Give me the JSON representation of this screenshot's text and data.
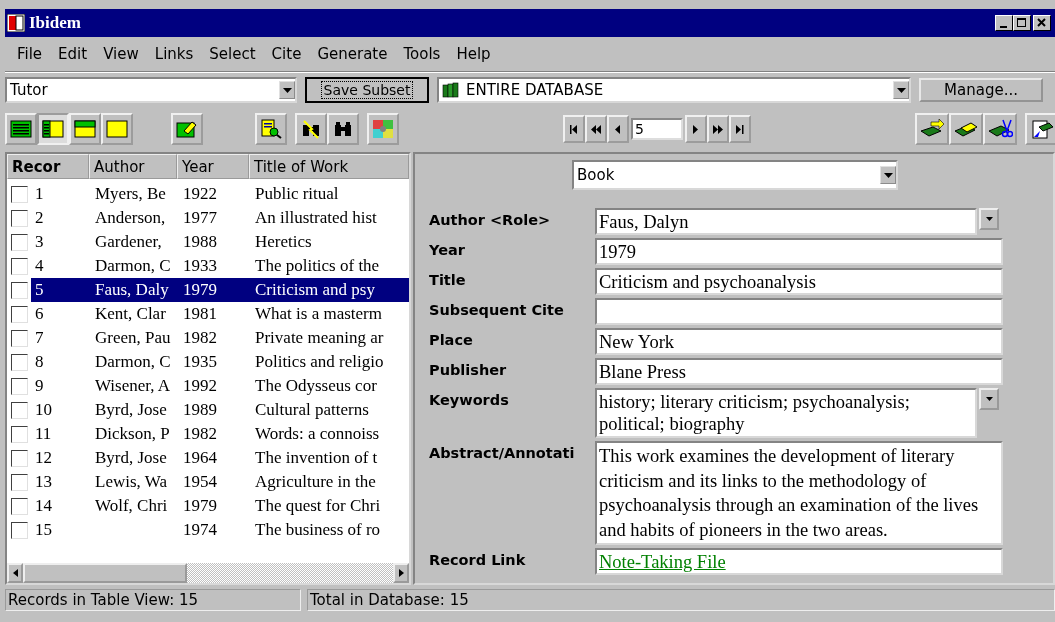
{
  "window": {
    "title": "Ibidem"
  },
  "menu": [
    "File",
    "Edit",
    "View",
    "Links",
    "Select",
    "Cite",
    "Generate",
    "Tools",
    "Help"
  ],
  "database_combo": {
    "value": "Tutor"
  },
  "save_subset_button": "Save Subset",
  "subset_combo": {
    "value": "ENTIRE DATABASE"
  },
  "manage_button": "Manage...",
  "view_buttons": [
    {
      "selected": false
    },
    {
      "selected": true
    },
    {
      "selected": false
    },
    {
      "selected": false
    }
  ],
  "record_navigator": {
    "value": "5"
  },
  "table": {
    "columns": [
      "Recor",
      "Author",
      "Year",
      "Title of Work"
    ],
    "rows": [
      {
        "checked": false,
        "selected": false,
        "record": "1",
        "author": "Myers, Be",
        "year": "1922",
        "title": "Public ritual"
      },
      {
        "checked": false,
        "selected": false,
        "record": "2",
        "author": "Anderson,",
        "year": "1977",
        "title": "An illustrated hist"
      },
      {
        "checked": false,
        "selected": false,
        "record": "3",
        "author": "Gardener,",
        "year": "1988",
        "title": "Heretics"
      },
      {
        "checked": false,
        "selected": false,
        "record": "4",
        "author": "Darmon, C",
        "year": "1933",
        "title": "The politics of the"
      },
      {
        "checked": false,
        "selected": true,
        "record": "5",
        "author": "Faus, Daly",
        "year": "1979",
        "title": "Criticism and psy"
      },
      {
        "checked": false,
        "selected": false,
        "record": "6",
        "author": "Kent, Clar",
        "year": "1981",
        "title": "What is a masterm"
      },
      {
        "checked": false,
        "selected": false,
        "record": "7",
        "author": "Green, Pau",
        "year": "1982",
        "title": "Private meaning ar"
      },
      {
        "checked": false,
        "selected": false,
        "record": "8",
        "author": "Darmon, C",
        "year": "1935",
        "title": "Politics and religio"
      },
      {
        "checked": false,
        "selected": false,
        "record": "9",
        "author": "Wisener, A",
        "year": "1992",
        "title": "The Odysseus cor"
      },
      {
        "checked": false,
        "selected": false,
        "record": "10",
        "author": "Byrd, Jose",
        "year": "1989",
        "title": "Cultural patterns"
      },
      {
        "checked": false,
        "selected": false,
        "record": "11",
        "author": "Dickson, P",
        "year": "1982",
        "title": "Words: a connoiss"
      },
      {
        "checked": false,
        "selected": false,
        "record": "12",
        "author": "Byrd, Jose",
        "year": "1964",
        "title": "The invention of t"
      },
      {
        "checked": false,
        "selected": false,
        "record": "13",
        "author": "Lewis, Wa",
        "year": "1954",
        "title": "Agriculture in the"
      },
      {
        "checked": false,
        "selected": false,
        "record": "14",
        "author": "Wolf, Chri",
        "year": "1979",
        "title": "The quest for Chri"
      },
      {
        "checked": false,
        "selected": false,
        "record": "15",
        "year": "1974",
        "title": "The business of ro"
      }
    ]
  },
  "record_type": {
    "value": "Book"
  },
  "fields": [
    {
      "kind": "dropdown",
      "label": "Author <Role>",
      "value": "Faus, Dalyn"
    },
    {
      "kind": "text",
      "label": "Year",
      "value": "1979"
    },
    {
      "kind": "text",
      "label": "Title",
      "value": "Criticism and psychoanalysis"
    },
    {
      "kind": "text",
      "label": "Subsequent Cite"
    },
    {
      "kind": "text",
      "label": "Place",
      "value": "New York"
    },
    {
      "kind": "text",
      "label": "Publisher",
      "value": "Blane Press"
    },
    {
      "kind": "multi",
      "label": "Keywords",
      "value": "history; literary criticism; psychoanalysis; political; biography"
    },
    {
      "kind": "memo",
      "label": "Abstract/Annotati",
      "value": "This work examines the development of literary criticism and its links to the methodology of psychoanalysis through an examination of the lives and habits of pioneers in the two areas."
    },
    {
      "kind": "link",
      "label": "Record Link",
      "value": "Note-Taking File"
    }
  ],
  "status_bar": [
    "Records in Table View: 15",
    "Total in Database: 15"
  ]
}
